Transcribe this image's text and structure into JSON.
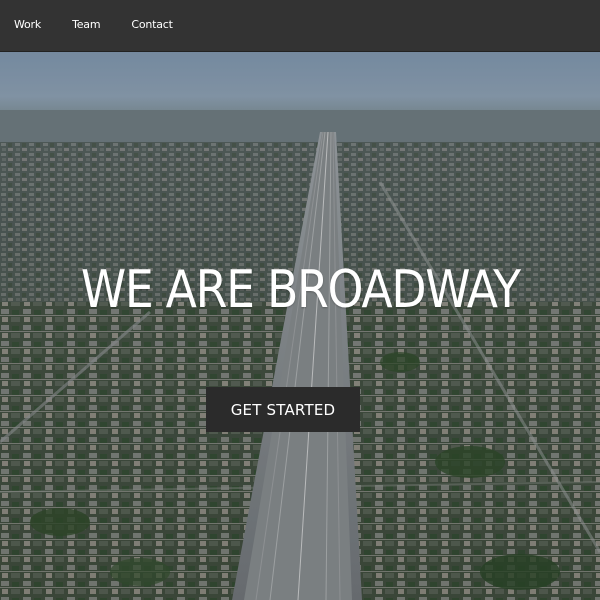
{
  "nav": {
    "links": [
      {
        "label": "Work"
      },
      {
        "label": "Team"
      },
      {
        "label": "Contact"
      }
    ]
  },
  "hero": {
    "title": "WE ARE BROADWAY",
    "cta_label": "GET STARTED",
    "background": "aerial photo of a freeway cutting through a dense city grid"
  },
  "colors": {
    "navbar_bg": "#333333",
    "nav_text": "#ffffff",
    "cta_bg": "#2b2b2b",
    "title_text": "#ffffff"
  }
}
